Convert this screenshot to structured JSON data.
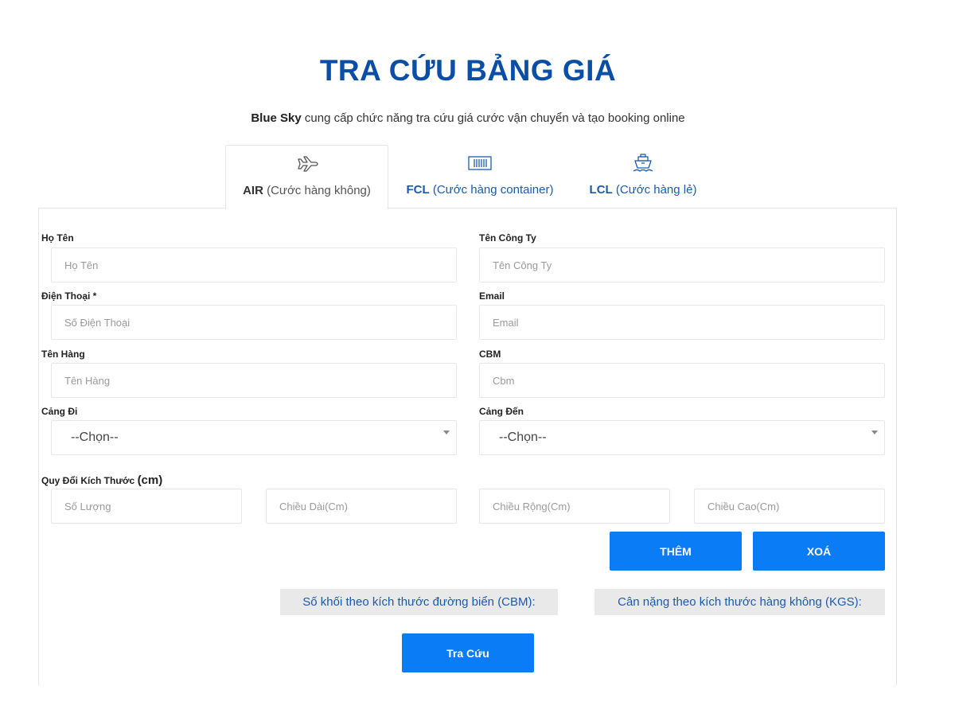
{
  "header": {
    "title": "TRA CỨU BẢNG GIÁ",
    "subtitle_brand": "Blue Sky",
    "subtitle_rest": " cung cấp chức năng tra cứu giá cước vận chuyển và tạo booking online"
  },
  "tabs": [
    {
      "code": "AIR",
      "label": " (Cước hàng không)",
      "icon": "airplane-icon",
      "active": true
    },
    {
      "code": "FCL",
      "label": " (Cước hàng container)",
      "icon": "container-icon",
      "active": false
    },
    {
      "code": "LCL",
      "label": " (Cước hàng lẻ)",
      "icon": "ship-icon",
      "active": false
    }
  ],
  "form": {
    "full_name": {
      "label": "Họ Tên",
      "placeholder": "Họ Tên",
      "value": ""
    },
    "company": {
      "label": "Tên Công Ty",
      "placeholder": "Tên Công Ty",
      "value": ""
    },
    "phone": {
      "label": "Điện Thoại *",
      "placeholder": "Số Điện Thoại",
      "value": ""
    },
    "email": {
      "label": "Email",
      "placeholder": "Email",
      "value": ""
    },
    "goods": {
      "label": "Tên Hàng",
      "placeholder": "Tên Hàng",
      "value": ""
    },
    "cbm": {
      "label": "CBM",
      "placeholder": "Cbm",
      "value": ""
    },
    "origin_port": {
      "label": "Cảng Đi",
      "selected": "--Chọn--"
    },
    "destination_port": {
      "label": "Cảng Đến",
      "selected": "--Chọn--"
    },
    "dimensions": {
      "label": "Quy Đổi Kích Thước ",
      "unit": "(cm)",
      "quantity_placeholder": "Số Lượng",
      "length_placeholder": "Chiều Dài(Cm)",
      "width_placeholder": "Chiều Rộng(Cm)",
      "height_placeholder": "Chiều Cao(Cm)"
    },
    "add_button": "THÊM",
    "delete_button": "XOÁ",
    "sea_volume_label": "Số khối theo kích thước đường biển (CBM):",
    "air_weight_label": "Cân nặng theo kích thước hàng không (KGS):",
    "search_button": "Tra Cứu"
  },
  "colors": {
    "title": "#0a4ea6",
    "accent_button": "#0a7cf5",
    "tab_link": "#1a5bb0",
    "result_bg": "#e9e9e9"
  }
}
